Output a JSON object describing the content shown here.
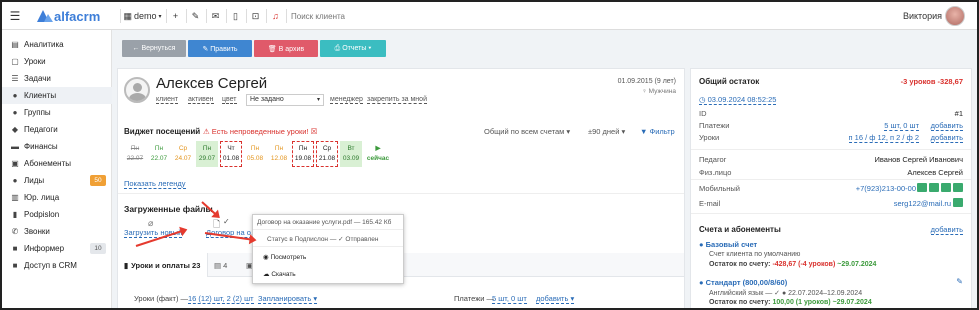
{
  "topbar": {
    "logo_text": "alfacrm",
    "branch": "demo",
    "search_placeholder": "Поиск клиента",
    "user_name": "Виктория"
  },
  "sidebar": {
    "items": [
      {
        "label": "Аналитика",
        "icon": "bar-chart-icon"
      },
      {
        "label": "Уроки",
        "icon": "calendar-icon"
      },
      {
        "label": "Задачи",
        "icon": "list-icon"
      },
      {
        "label": "Клиенты",
        "icon": "user-icon",
        "active": true
      },
      {
        "label": "Группы",
        "icon": "users-icon"
      },
      {
        "label": "Педагоги",
        "icon": "graduation-cap-icon"
      },
      {
        "label": "Финансы",
        "icon": "money-icon"
      },
      {
        "label": "Абонементы",
        "icon": "ticket-icon"
      },
      {
        "label": "Лиды",
        "icon": "user-plus-icon",
        "badge": "50"
      },
      {
        "label": "Юр. лица",
        "icon": "building-icon"
      },
      {
        "label": "Podpislon",
        "icon": "file-icon"
      },
      {
        "label": "Звонки",
        "icon": "phone-icon"
      },
      {
        "label": "Информер",
        "icon": "bell-icon",
        "badge": "10"
      },
      {
        "label": "Доступ в CRM",
        "icon": "lock-icon"
      }
    ]
  },
  "actions": {
    "back": "← Вернуться",
    "edit": "✎ Править",
    "archive": "🗑 В архив",
    "reports": "⎙ Отчеты ▾"
  },
  "client": {
    "name": "Алексев Сергей",
    "tags": [
      "клиент",
      "активен",
      "цвет"
    ],
    "status_select": "Не задано",
    "manager": "менеджер",
    "assign": "закрепить за мной",
    "dob": "01.09.2015 (9 лет)",
    "gender": "♀ Мужчина"
  },
  "widget": {
    "title": "Виджет посещений",
    "warning": "⚠ Есть непроведенные уроки! ☒",
    "filter_accounts": "Общий по всем счетам ▾",
    "filter_days": "±90 дней ▾",
    "filter_btn": "▼ Фильтр",
    "days": [
      {
        "dow": "Пн",
        "date": "22.07",
        "cls": "strike"
      },
      {
        "dow": "Пн",
        "date": "22.07",
        "cls": "green"
      },
      {
        "dow": "Ср",
        "date": "24.07",
        "cls": "orange"
      },
      {
        "dow": "Пн",
        "date": "29.07",
        "cls": "greenbg"
      },
      {
        "dow": "Чт",
        "date": "01.08",
        "cls": "dashed"
      },
      {
        "dow": "Пн",
        "date": "05.08",
        "cls": "orange"
      },
      {
        "dow": "Пн",
        "date": "12.08",
        "cls": "orange"
      },
      {
        "dow": "Пн",
        "date": "19.08",
        "cls": "dashed"
      },
      {
        "dow": "Ср",
        "date": "21.08",
        "cls": "dashed"
      },
      {
        "dow": "Вт",
        "date": "03.09",
        "cls": "greenbg"
      },
      {
        "dow": "▶",
        "date": "сейчас",
        "cls": "now"
      }
    ],
    "legend": "Показать легенду"
  },
  "files": {
    "title": "Загруженные файлы",
    "upload": "Загрузить новый",
    "contract": "Договор на о...",
    "popup_title": "Договор на оказание услуги.pdf — 165.42 Кб",
    "popup_status": "Статус в Подпислон — ✓ Отправлен",
    "view": "Посмотреть",
    "download": "Скачать"
  },
  "tabs": {
    "lessons": "Уроки и оплаты 23",
    "second": "4",
    "third": "4"
  },
  "lessons_row": {
    "fact_label": "Уроки (факт) —",
    "fact_value": "16 (12) шт, 2 (2) шт",
    "plan": "Запланировать ▾",
    "payments_label": "Платежи —",
    "payments_value": "5 шт, 0 шт",
    "add": "добавить ▾"
  },
  "balance": {
    "title": "Общий остаток",
    "value": "-3 уроков   -328,67",
    "date": "◷ 03.09.2024 08:52:25",
    "id_label": "ID",
    "id_value": "#1",
    "payments_label": "Платежи",
    "payments_value": "5 шт, 0 шт",
    "payments_add": "добавить",
    "lessons_label": "Уроки",
    "lessons_value": "п 16 / ф 12, п 2 / ф 2",
    "lessons_add": "добавить"
  },
  "info": {
    "teacher_label": "Педагог",
    "teacher_value": "Иванов Сергей Иванович",
    "person_label": "Физ.лицо",
    "person_value": "Алексев Сергей",
    "mobile_label": "Мобильный",
    "mobile_value": "+7(923)213-00-00",
    "email_label": "E-mail",
    "email_value": "serg122@mail.ru"
  },
  "accounts": {
    "title": "Счета и абонементы",
    "add": "добавить",
    "base_title": "Базовый счет",
    "base_desc": "Счет клиента по умолчанию",
    "base_balance_label": "Остаток по счету:",
    "base_balance_value": "-428,67 (-4 уроков)",
    "base_balance_date": "~29.07.2024",
    "std_title": "Стандарт (800,00/8/60)",
    "std_desc": "Английский язык — ✓ ●  22.07.2024–12.09.2024",
    "std_balance_label": "Остаток по счету:",
    "std_balance_value": "100,00 (1 уроков)",
    "std_balance_date": "~29.07.2024"
  },
  "colors": {
    "brand": "#3d7ed8",
    "back_btn": "#9aa1a9",
    "edit_btn": "#3f86d1",
    "archive_btn": "#e05a6a",
    "reports_btn": "#3bbdc1",
    "red": "#d9322e",
    "green": "#3c9a3c"
  }
}
